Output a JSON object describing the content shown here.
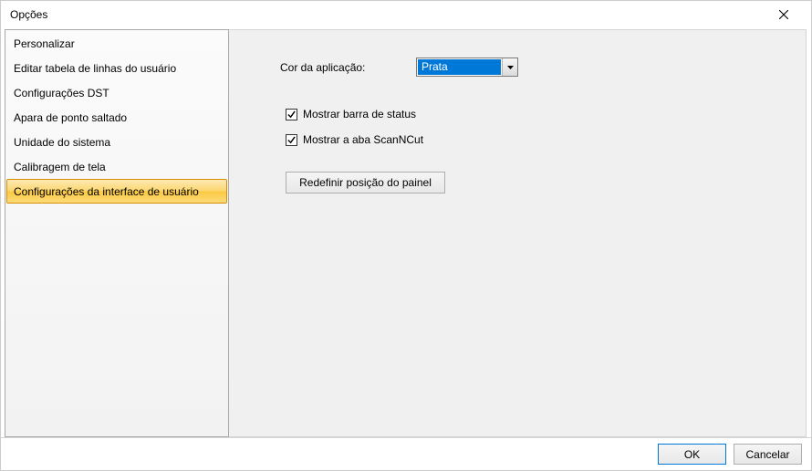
{
  "titlebar": {
    "title": "Opções"
  },
  "sidebar": {
    "items": [
      {
        "label": "Personalizar"
      },
      {
        "label": "Editar tabela de linhas do usuário"
      },
      {
        "label": "Configurações DST"
      },
      {
        "label": "Apara de ponto saltado"
      },
      {
        "label": "Unidade do sistema"
      },
      {
        "label": "Calibragem de tela"
      },
      {
        "label": "Configurações da interface de usuário"
      }
    ],
    "selected_index": 6
  },
  "content": {
    "color_label": "Cor da aplicação:",
    "color_value": "Prata",
    "show_statusbar_label": "Mostrar barra de status",
    "show_statusbar_checked": true,
    "show_scanncut_label": "Mostrar a aba ScanNCut",
    "show_scanncut_checked": true,
    "reset_panel_label": "Redefinir posição do painel"
  },
  "footer": {
    "ok_label": "OK",
    "cancel_label": "Cancelar"
  }
}
